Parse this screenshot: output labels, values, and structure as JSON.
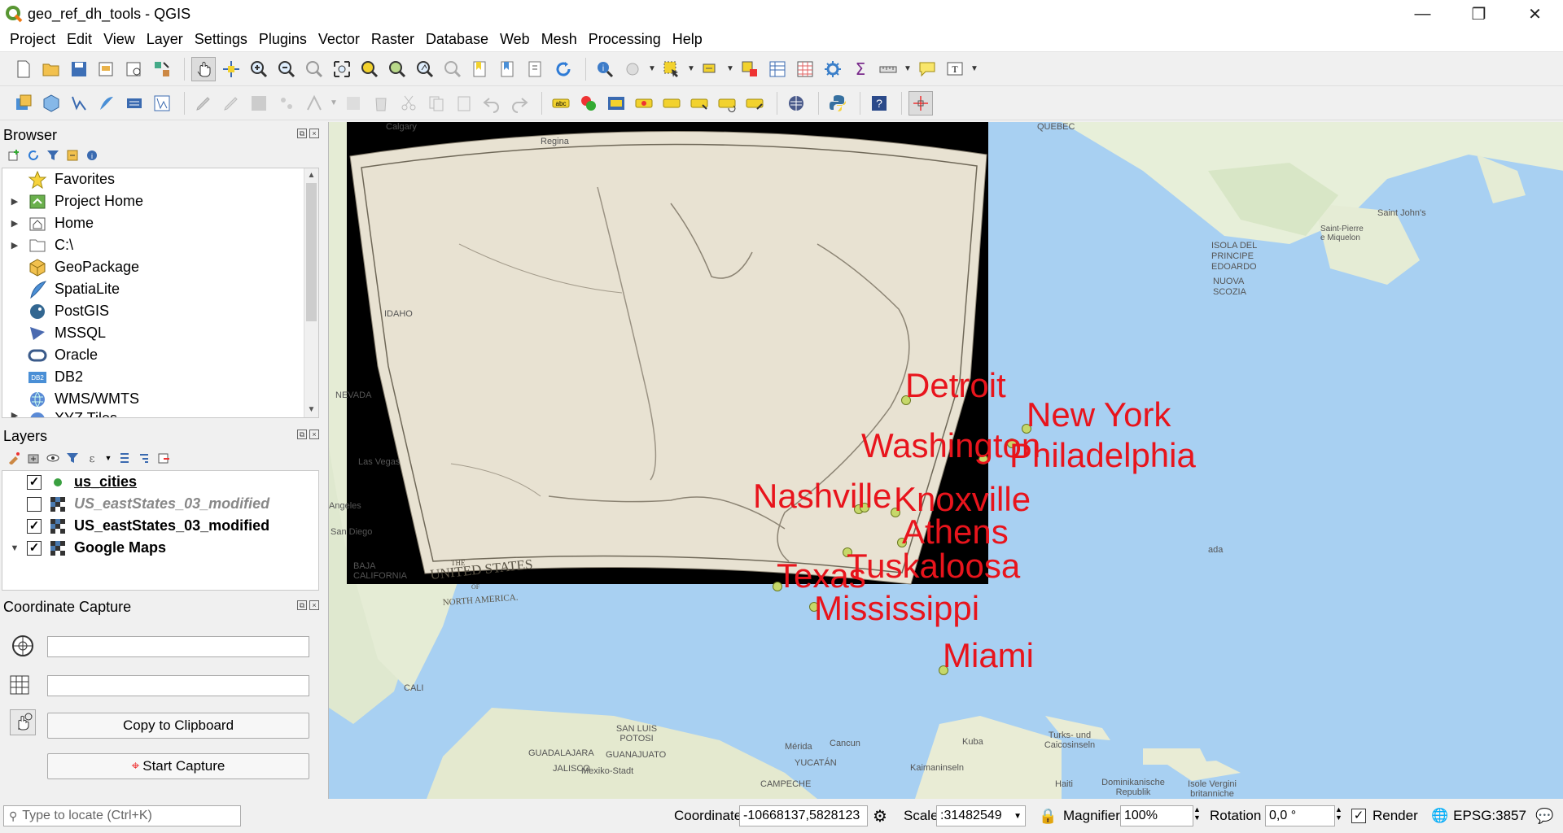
{
  "window": {
    "title": "geo_ref_dh_tools - QGIS",
    "minimize": "—",
    "restore": "❐",
    "close": "✕"
  },
  "menu": [
    "Project",
    "Edit",
    "View",
    "Layer",
    "Settings",
    "Plugins",
    "Vector",
    "Raster",
    "Database",
    "Web",
    "Mesh",
    "Processing",
    "Help"
  ],
  "browser": {
    "title": "Browser",
    "items": [
      {
        "label": "Favorites",
        "icon": "star-icon",
        "expand": ""
      },
      {
        "label": "Project Home",
        "icon": "project-home-icon",
        "expand": "▶"
      },
      {
        "label": "Home",
        "icon": "home-icon",
        "expand": "▶"
      },
      {
        "label": "C:\\",
        "icon": "drive-icon",
        "expand": "▶"
      },
      {
        "label": "GeoPackage",
        "icon": "geopackage-icon",
        "expand": ""
      },
      {
        "label": "SpatiaLite",
        "icon": "spatialite-icon",
        "expand": ""
      },
      {
        "label": "PostGIS",
        "icon": "postgis-icon",
        "expand": ""
      },
      {
        "label": "MSSQL",
        "icon": "mssql-icon",
        "expand": ""
      },
      {
        "label": "Oracle",
        "icon": "oracle-icon",
        "expand": ""
      },
      {
        "label": "DB2",
        "icon": "db2-icon",
        "expand": ""
      },
      {
        "label": "WMS/WMTS",
        "icon": "wms-icon",
        "expand": ""
      },
      {
        "label": "XYZ Tiles",
        "icon": "xyz-icon",
        "expand": "▶"
      }
    ]
  },
  "layers": {
    "title": "Layers",
    "items": [
      {
        "label": "us_cities",
        "checked": "✓",
        "expand": "",
        "underline": true,
        "disabled": false,
        "icon": "point-layer-icon"
      },
      {
        "label": "US_eastStates_03_modified",
        "checked": "",
        "expand": "",
        "underline": false,
        "disabled": true,
        "icon": "raster-layer-icon"
      },
      {
        "label": "US_eastStates_03_modified",
        "checked": "✓",
        "expand": "",
        "underline": false,
        "disabled": false,
        "icon": "raster-layer-icon"
      },
      {
        "label": "Google Maps",
        "checked": "✓",
        "expand": "▼",
        "underline": false,
        "disabled": false,
        "icon": "raster-layer-icon"
      }
    ]
  },
  "capture": {
    "title": "Coordinate Capture",
    "field1": "",
    "field2": "",
    "copy_label": "Copy to Clipboard",
    "start_label": "Start Capture"
  },
  "map": {
    "labels": [
      {
        "text": "Detroit"
      },
      {
        "text": "New York"
      },
      {
        "text": "Washington"
      },
      {
        "text": "Philadelphia"
      },
      {
        "text": "Nashville"
      },
      {
        "text": "Knoxville"
      },
      {
        "text": "Athens"
      },
      {
        "text": "Tuskaloosa"
      },
      {
        "text": "Texas"
      },
      {
        "text": "Mississippi"
      },
      {
        "text": "Miami"
      }
    ],
    "basemap_labels": [
      "Calgary",
      "Regina",
      "QUEBEC",
      "Saint John's",
      "Saint-Pierre e Miquelon",
      "ISOLA DEL PRINCIPE EDOARDO",
      "NUOVA SCOZIA",
      "IDAHO",
      "NEVADA",
      "Las Vegas",
      "Angeles",
      "San Diego",
      "BAJA CALIFORNIA",
      "CALI",
      "SAN LUIS POTOSI",
      "GUADALAJARA",
      "GUANAJUATO",
      "JALISCO",
      "Mexiko-Stadt",
      "Mérida",
      "Cancun",
      "YUCATÁN",
      "CAMPECHE",
      "Kuba",
      "Turks- und Caicosinseln",
      "Kaimaninseln",
      "Haiti",
      "Dominikanische Republik",
      "Isole Vergini britanniche",
      "ada"
    ],
    "map_title_line1": "UNITED STATES",
    "map_title_line2": "NORTH AMERICA.",
    "map_title_small": "THE",
    "map_title_of": "OF"
  },
  "status": {
    "locate_placeholder": "Type to locate (Ctrl+K)",
    "coord_label": "Coordinate",
    "coord_value": "-10668137,5828123",
    "scale_label": "Scale",
    "scale_value": ":31482549",
    "magnifier_label": "Magnifier",
    "magnifier_value": "100%",
    "rotation_label": "Rotation",
    "rotation_value": "0,0 °",
    "render_label": "Render",
    "render_checked": "✓",
    "crs": "EPSG:3857"
  }
}
